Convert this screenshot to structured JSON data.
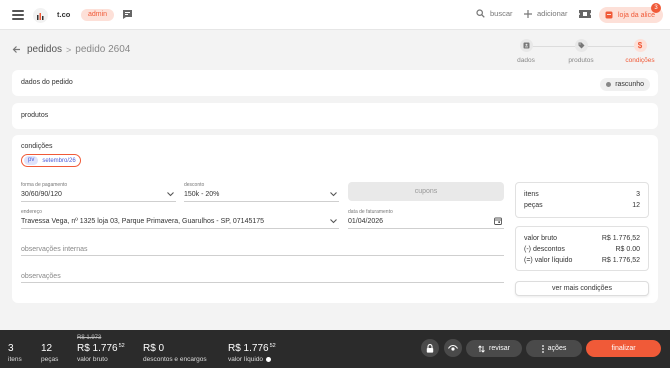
{
  "app": {
    "brand": "t.co",
    "role_badge": "admin",
    "search_label": "buscar",
    "add_label": "adicionar",
    "store_label": "loja da alice",
    "notification_count": "3"
  },
  "breadcrumb": {
    "parent": "pedidos",
    "separator": ">",
    "current": "pedido 2604"
  },
  "steps": [
    {
      "label": "dados",
      "icon": "id-card-icon"
    },
    {
      "label": "produtos",
      "icon": "tag-icon"
    },
    {
      "label": "condições",
      "icon": "dollar-icon",
      "symbol": "$",
      "active": true
    }
  ],
  "order_data": {
    "title": "dados do pedido",
    "status": "rascunho"
  },
  "products": {
    "title": "produtos"
  },
  "conditions": {
    "title": "condições",
    "price_table_tag": "pv",
    "price_table_name": "setembro/26",
    "payment": {
      "label": "forma de pagamento",
      "value": "30/60/90/120"
    },
    "discount": {
      "label": "desconto",
      "value": "150k - 20%"
    },
    "coupons_label": "cupons",
    "address": {
      "label": "endereço",
      "value": "Travessa Vega, nº 1325 loja 03, Parque Primavera, Guarulhos - SP, 07145175"
    },
    "billing_date": {
      "label": "data de faturamento",
      "value": "01/04/2026"
    },
    "internal_notes_placeholder": "observações internas",
    "notes_placeholder": "observações"
  },
  "summary": {
    "items_label": "itens",
    "items_value": "3",
    "pieces_label": "peças",
    "pieces_value": "12",
    "gross_label": "valor bruto",
    "gross_value": "R$ 1.776,52",
    "discounts_label": "(-) descontos",
    "discounts_value": "R$ 0.00",
    "net_label": "(=) valor líquido",
    "net_value": "R$ 1.776,52",
    "more_conditions": "ver mais condições"
  },
  "footer": {
    "items_value": "3",
    "items_label": "itens",
    "pieces_value": "12",
    "pieces_label": "peças",
    "gross_old": "R$ 1.973",
    "gross_main": "R$ 1.776",
    "gross_cents": "52",
    "gross_label": "valor bruto",
    "discounts_value": "R$ 0",
    "discounts_label": "descontos e encargos",
    "net_main": "R$ 1.776",
    "net_cents": "52",
    "net_label": "valor líquido",
    "review_label": "revisar",
    "actions_label": "ações",
    "finish_label": "finalizar"
  },
  "colors": {
    "accent": "#f05a38",
    "accent_soft": "#fde0d8",
    "tag_blue": "#4a5bd8",
    "footer_bg": "#2b2b2b"
  }
}
